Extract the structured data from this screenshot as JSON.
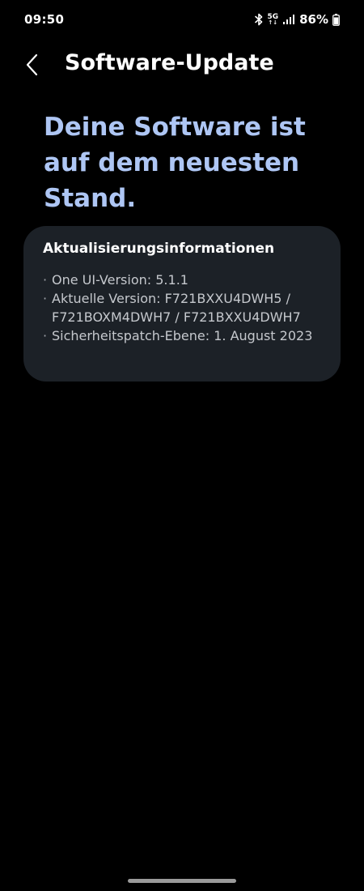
{
  "status_bar": {
    "time": "09:50",
    "network_label": "5G",
    "battery_percent": "86%",
    "battery_level": 0.86,
    "icons": [
      "bluetooth-icon",
      "network-5g-icon",
      "signal-icon",
      "battery-icon"
    ]
  },
  "app_bar": {
    "title": "Software-Update",
    "back_icon": "chevron-left-icon"
  },
  "headline": "Deine Software ist auf dem neuesten Stand.",
  "info_card": {
    "title": "Aktualisierungsinformationen",
    "items": [
      "One UI-Version: 5.1.1",
      "Aktuelle Version: F721BXXU4DWH5 / F721BOXM4DWH7 / F721BXXU4DWH7",
      "Sicherheitspatch-Ebene: 1. August 2023"
    ]
  },
  "colors": {
    "background": "#000000",
    "headline": "#aec6f4",
    "card_background": "#1c2127",
    "card_text": "#c5c8cd"
  }
}
